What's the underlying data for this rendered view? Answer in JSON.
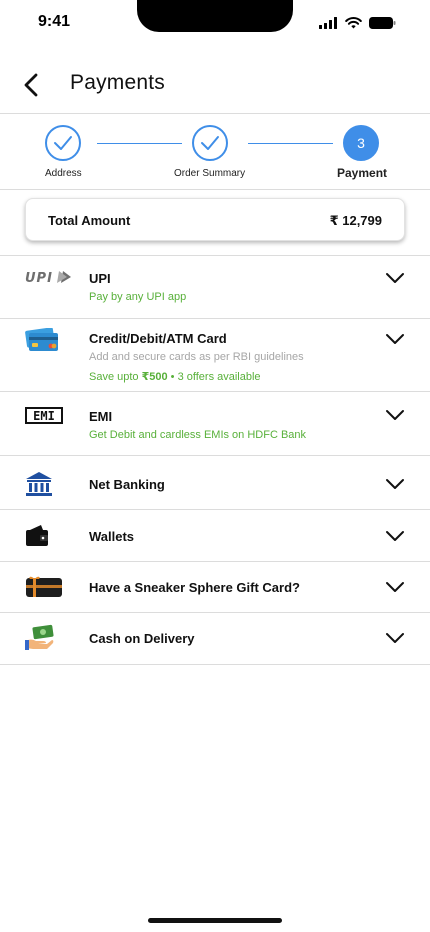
{
  "status_bar": {
    "time": "9:41"
  },
  "header": {
    "title": "Payments"
  },
  "stepper": {
    "steps": [
      {
        "label": "Address",
        "state": "done"
      },
      {
        "label": "Order Summary",
        "state": "done"
      },
      {
        "label": "Payment",
        "state": "active",
        "number": "3"
      }
    ]
  },
  "total": {
    "label": "Total Amount",
    "value": "₹ 12,799"
  },
  "options": [
    {
      "title": "UPI",
      "subtitle": "Pay by any UPI app",
      "icon": "upi-logo"
    },
    {
      "title": "Credit/Debit/ATM Card",
      "subtitle": "Add and secure cards as per RBI guidelines",
      "offer_prefix": "Save upto ",
      "offer_amount": "₹500",
      "offer_sep": " • ",
      "offer_count": "3 offers available",
      "icon": "credit-card"
    },
    {
      "title": "EMI",
      "subtitle": "Get Debit and  cardless EMIs on HDFC Bank",
      "icon": "emi-badge"
    },
    {
      "title": "Net Banking",
      "icon": "bank"
    },
    {
      "title": "Wallets",
      "icon": "wallet"
    },
    {
      "title": "Have a Sneaker Sphere Gift Card?",
      "icon": "gift-card"
    },
    {
      "title": "Cash on Delivery",
      "icon": "cash-hand"
    }
  ],
  "colors": {
    "accent": "#3f8ee8",
    "offer_green": "#58b03a",
    "divider": "#dcdcdc"
  }
}
